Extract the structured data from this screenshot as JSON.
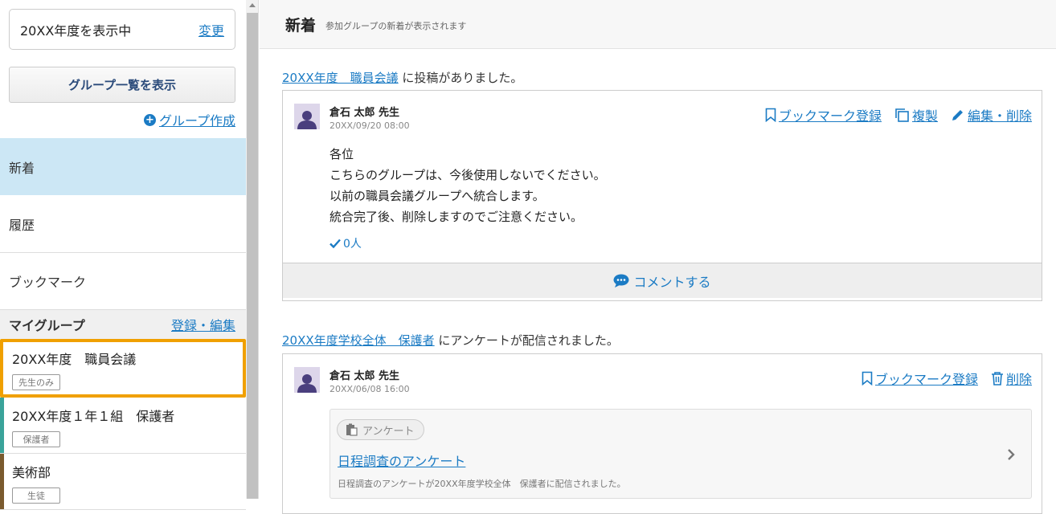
{
  "sidebar": {
    "year_label": "20XX年度を表示中",
    "year_change": "変更",
    "group_list_button": "グループ一覧を表示",
    "create_group": "グループ作成",
    "nav": [
      {
        "label": "新着"
      },
      {
        "label": "履歴"
      },
      {
        "label": "ブックマーク"
      }
    ],
    "mygroup_title": "マイグループ",
    "mygroup_edit": "登録・編集",
    "groups": [
      {
        "name": "20XX年度　職員会議",
        "tag": "先生のみ",
        "color": "#f0a000"
      },
      {
        "name": "20XX年度１年１組　保護者",
        "tag": "保護者",
        "color": "#3aa39a"
      },
      {
        "name": "美術部",
        "tag": "生徒",
        "color": "#7a5a2e"
      }
    ]
  },
  "main": {
    "title": "新着",
    "subtitle": "参加グループの新着が表示されます",
    "posts": [
      {
        "group_link": "20XX年度　職員会議",
        "caption_suffix": "に投稿がありました。",
        "author": "倉石 太郎 先生",
        "date": "20XX/09/20 08:00",
        "actions": {
          "bookmark": "ブックマーク登録",
          "copy": "複製",
          "edit": "編集・削除"
        },
        "body": [
          "各位",
          "こちらのグループは、今後使用しないでください。",
          "以前の職員会議グループへ統合します。",
          "統合完了後、削除しますのでご注意ください。"
        ],
        "likes": "0人",
        "comment": "コメントする"
      },
      {
        "group_link": "20XX年度学校全体　保護者",
        "caption_suffix": "にアンケートが配信されました。",
        "author": "倉石 太郎 先生",
        "date": "20XX/06/08 16:00",
        "actions": {
          "bookmark": "ブックマーク登録",
          "delete": "削除"
        },
        "survey": {
          "chip": "アンケート",
          "title": "日程調査のアンケート",
          "desc": "日程調査のアンケートが20XX年度学校全体　保護者に配信されました。"
        }
      }
    ]
  },
  "colors": {
    "accent": "#1b7bc4",
    "active_nav": "#cce7f5",
    "selected_group": "#f0a000"
  }
}
